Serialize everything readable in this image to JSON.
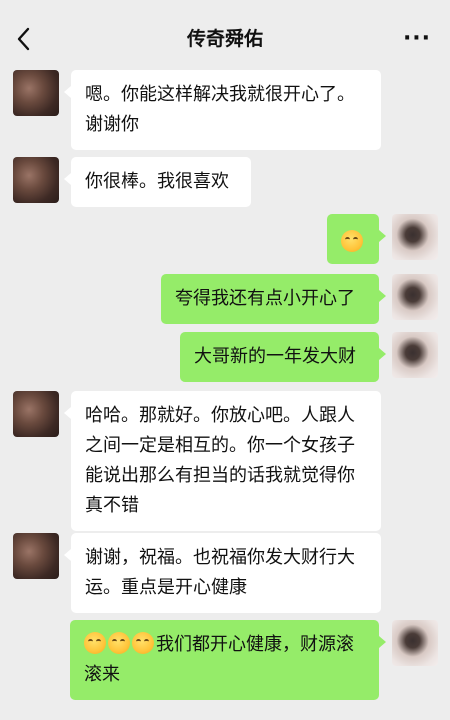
{
  "header": {
    "title": "传奇舜佑",
    "more_label": "···"
  },
  "icons": {
    "back": "back-chevron-icon",
    "more": "more-dots-icon",
    "emoji_laugh": "laugh-cry-emoji",
    "emoji_shy": "shy-smile-emoji"
  },
  "colors": {
    "background": "#ededed",
    "incoming_bubble": "#ffffff",
    "outgoing_bubble": "#95ec69"
  },
  "messages": [
    {
      "side": "left",
      "lines": [
        "嗯。你能这样解决我就很开心了。",
        "谢谢你"
      ]
    },
    {
      "side": "left",
      "lines": [
        "你很棒。我很喜欢"
      ]
    },
    {
      "side": "right",
      "lines": [
        ""
      ]
    },
    {
      "side": "right",
      "lines": [
        "夸得我还有点小开心了"
      ]
    },
    {
      "side": "right",
      "lines": [
        "大哥新的一年发大财"
      ]
    },
    {
      "side": "left",
      "lines": [
        "哈哈。那就好。你放心吧。人跟人",
        "之间一定是相互的。你一个女孩子",
        "能说出那么有担当的话我就觉得你",
        "真不错"
      ]
    },
    {
      "side": "left",
      "lines": [
        "谢谢，祝福。也祝福你发大财行大",
        "运。重点是开心健康"
      ]
    },
    {
      "side": "right",
      "lines": [
        "我们都开心健康，财源滚",
        "滚来"
      ]
    }
  ]
}
